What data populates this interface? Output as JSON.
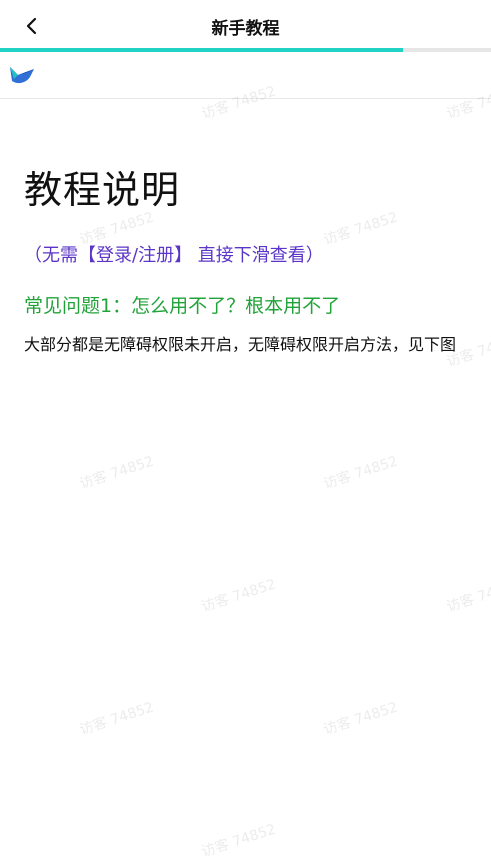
{
  "header": {
    "title": "新手教程",
    "back_icon": "chevron-left-icon"
  },
  "progress": {
    "value": 0.82,
    "color": "#22d3c5"
  },
  "content": {
    "heading": "教程说明",
    "hint": "（无需【登录/注册】 直接下滑查看）",
    "question_title": "常见问题1：怎么用不了？根本用不了",
    "question_body": "大部分都是无障碍权限未开启，无障碍权限开启方法，见下图"
  },
  "watermark": {
    "text": "访客 74852"
  },
  "colors": {
    "hint": "#5b35c8",
    "question_title": "#22a33a",
    "accent": "#22d3c5"
  }
}
